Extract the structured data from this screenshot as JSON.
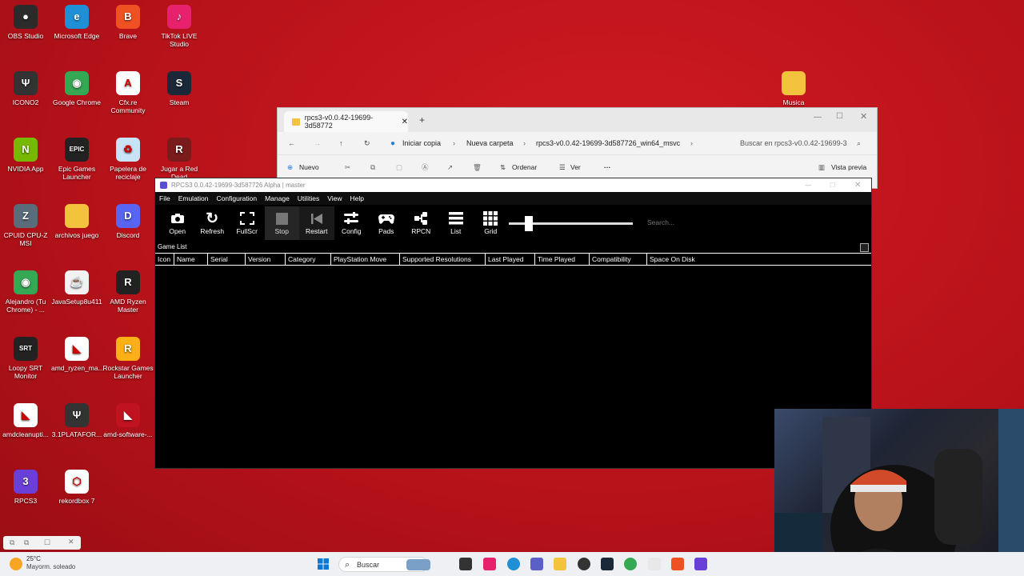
{
  "desktop": {
    "icons": [
      {
        "label": "OBS Studio",
        "color": "#2b2b2b",
        "glyph": "●"
      },
      {
        "label": "Microsoft Edge",
        "color": "#1f8fd6",
        "glyph": "e"
      },
      {
        "label": "Brave",
        "color": "#f05123",
        "glyph": "B"
      },
      {
        "label": "TikTok LIVE Studio",
        "color": "#e8216d",
        "glyph": "♪"
      },
      {
        "label": "ICONO2",
        "color": "#333",
        "glyph": "Ψ"
      },
      {
        "label": "Google Chrome",
        "color": "#34a853",
        "glyph": "◉"
      },
      {
        "label": "Cfx.re Community",
        "color": "#ffffff",
        "glyph": "A"
      },
      {
        "label": "Steam",
        "color": "#1b2838",
        "glyph": "S"
      },
      {
        "label": "NVIDIA App",
        "color": "#76b900",
        "glyph": "N"
      },
      {
        "label": "Epic Games Launcher",
        "color": "#222",
        "glyph": "EPIC"
      },
      {
        "label": "Papelera de reciclaje",
        "color": "#c7e3f5",
        "glyph": "♻"
      },
      {
        "label": "Jugar a Red Dead Redemption 2",
        "color": "#7a1b1b",
        "glyph": "R"
      },
      {
        "label": "CPUID CPU-Z MSI",
        "color": "#5a6b7a",
        "glyph": "Z"
      },
      {
        "label": "archivos juego",
        "color": "#f3c33d",
        "glyph": ""
      },
      {
        "label": "Discord",
        "color": "#5865f2",
        "glyph": "D"
      },
      {
        "label": "Alejandro (Tu Chrome) - ...",
        "color": "#34a853",
        "glyph": "◉"
      },
      {
        "label": "JavaSetup8u411",
        "color": "#f2f2f2",
        "glyph": "☕"
      },
      {
        "label": "AMD Ryzen Master",
        "color": "#222",
        "glyph": "R"
      },
      {
        "label": "Loopy SRT Monitor",
        "color": "#222",
        "glyph": "SRT"
      },
      {
        "label": "amd_ryzen_ma...",
        "color": "#fff",
        "glyph": "◣"
      },
      {
        "label": "Rockstar Games Launcher",
        "color": "#fcaf17",
        "glyph": "R"
      },
      {
        "label": "amdcleanupti...",
        "color": "#fff",
        "glyph": "◣"
      },
      {
        "label": "3.1PLATAFOR...",
        "color": "#333",
        "glyph": "Ψ"
      },
      {
        "label": "amd-software-...",
        "color": "#c1121f",
        "glyph": "◣"
      },
      {
        "label": "RPCS3",
        "color": "#6a3fd8",
        "glyph": "3"
      },
      {
        "label": "rekordbox 7",
        "color": "#fff",
        "glyph": "⬡"
      },
      {
        "label": "Musica",
        "color": "#f3c33d",
        "glyph": ""
      }
    ]
  },
  "explorer": {
    "tab_title": "rpcs3-v0.0.42-19699-3d58772",
    "breadcrumbs": [
      "Iniciar copia",
      "Nueva carpeta",
      "rpcs3-v0.0.42-19699-3d587726_win64_msvc"
    ],
    "search_placeholder": "Buscar en rpcs3-v0.0.42-19699-3",
    "commands": {
      "new": "Nuevo",
      "sort": "Ordenar",
      "view": "Ver",
      "more": "···",
      "preview": "Vista previa"
    }
  },
  "rpcs3": {
    "title": "RPCS3 0.0.42-19699-3d587726 Alpha | master",
    "menu": [
      "File",
      "Emulation",
      "Configuration",
      "Manage",
      "Utilities",
      "View",
      "Help"
    ],
    "toolbar": [
      "Open",
      "Refresh",
      "FullScr",
      "Stop",
      "Restart",
      "Config",
      "Pads",
      "RPCN",
      "List",
      "Grid"
    ],
    "search_placeholder": "Search...",
    "game_list_label": "Game List",
    "columns": [
      {
        "label": "Icon"
      },
      {
        "label": "Name"
      },
      {
        "label": "Serial"
      },
      {
        "label": "Version"
      },
      {
        "label": "Category"
      },
      {
        "label": "PlayStation Move"
      },
      {
        "label": "Supported Resolutions"
      },
      {
        "label": "Last Played"
      },
      {
        "label": "Time Played"
      },
      {
        "label": "Compatibility"
      },
      {
        "label": "Space On Disk"
      }
    ]
  },
  "taskbar": {
    "weather_temp": "25°C",
    "weather_desc": "Mayorm. soleado",
    "search_placeholder": "Buscar"
  }
}
